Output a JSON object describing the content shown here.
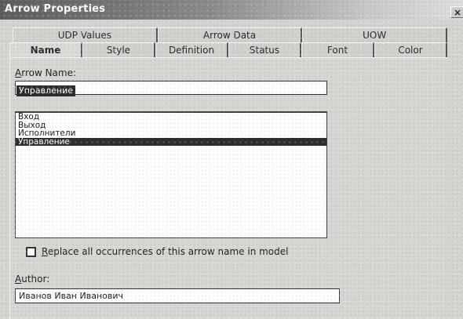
{
  "window": {
    "title": "Arrow Properties",
    "close_glyph": "×"
  },
  "tabs": {
    "back_row": [
      "UDP Values",
      "Arrow Data",
      "UOW"
    ],
    "front_row": [
      "Name",
      "Style",
      "Definition",
      "Status",
      "Font",
      "Color"
    ],
    "active": "Name"
  },
  "form": {
    "arrow_name_label_prefix": "A",
    "arrow_name_label_rest": "rrow Name:",
    "arrow_name_value": "Управление",
    "list_items": [
      "Вход",
      "Выход",
      "Исполнители",
      "Управление"
    ],
    "selected_item": "Управление",
    "replace_checked": false,
    "replace_label_prefix": "R",
    "replace_label_rest": "eplace all occurrences of this arrow name in model",
    "author_label_prefix": "A",
    "author_label_rest": "uthor:",
    "author_value": "Иванов Иван Иванович"
  }
}
